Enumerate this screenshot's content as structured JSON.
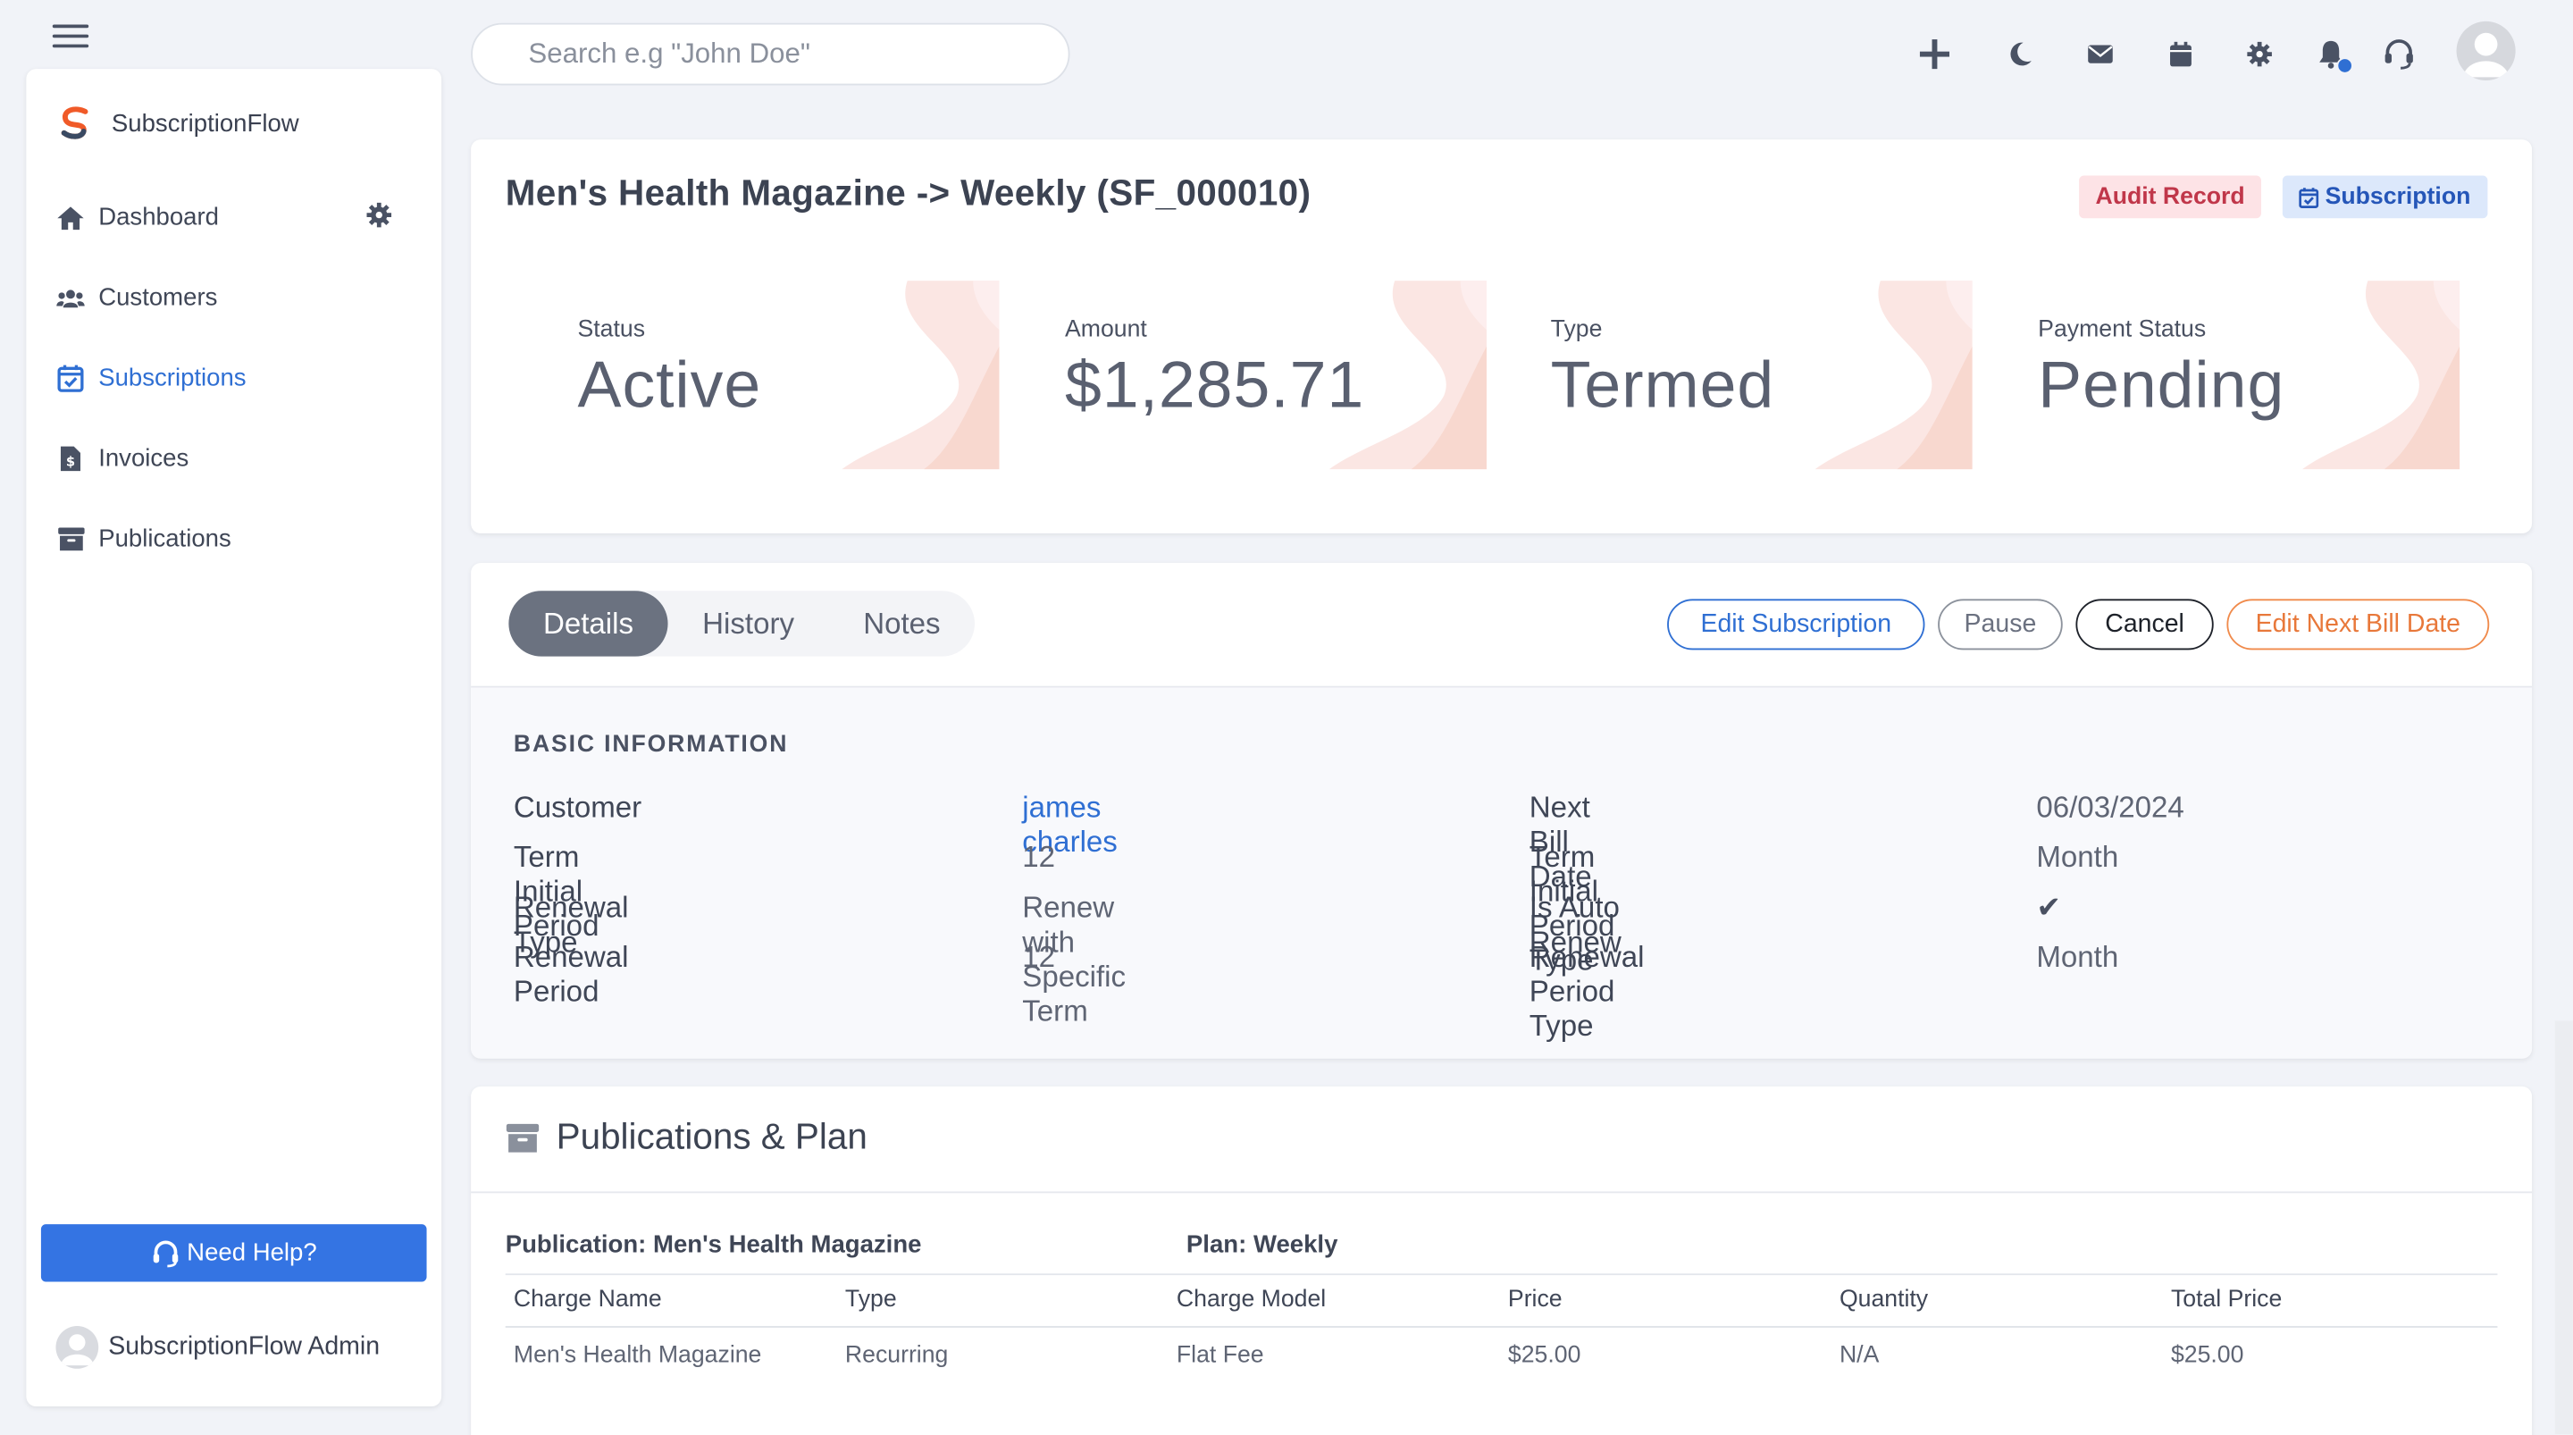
{
  "search": {
    "placeholder": "Search e.g \"John Doe\""
  },
  "sidebar": {
    "brand": "SubscriptionFlow",
    "items": [
      {
        "label": "Dashboard",
        "icon": "home-icon"
      },
      {
        "label": "Customers",
        "icon": "users-icon"
      },
      {
        "label": "Subscriptions",
        "icon": "calendar-check-icon",
        "active": true
      },
      {
        "label": "Invoices",
        "icon": "invoice-icon"
      },
      {
        "label": "Publications",
        "icon": "archive-icon"
      }
    ],
    "help_label": "Need Help?",
    "admin_name": "SubscriptionFlow Admin"
  },
  "topbar": {
    "icons": [
      "plus-icon",
      "moon-icon",
      "mail-icon",
      "calendar-icon",
      "gear-icon",
      "bell-icon",
      "headset-icon",
      "user-avatar"
    ]
  },
  "subscription": {
    "title": "Men's Health Magazine -> Weekly (SF_000010)",
    "badge_audit": "Audit Record",
    "badge_subscription": "Subscription",
    "stats": [
      {
        "label": "Status",
        "value": "Active"
      },
      {
        "label": "Amount",
        "value": "$1,285.71"
      },
      {
        "label": "Type",
        "value": "Termed"
      },
      {
        "label": "Payment Status",
        "value": "Pending"
      }
    ]
  },
  "details": {
    "tabs": [
      "Details",
      "History",
      "Notes"
    ],
    "buttons": {
      "edit": "Edit Subscription",
      "pause": "Pause",
      "cancel": "Cancel",
      "next_bill": "Edit Next Bill Date"
    },
    "section_title": "BASIC INFORMATION",
    "rows": [
      {
        "label": "Customer",
        "value": "james charles",
        "label2": "Next Bill Date",
        "value2": "06/03/2024"
      },
      {
        "label": "Term Initial Period",
        "value": "12",
        "label2": "Term Initial Period Type",
        "value2": "Month"
      },
      {
        "label": "Renewal Type",
        "value": "Renew with Specific Term",
        "label2": "Is Auto Renew",
        "value2": "✔"
      },
      {
        "label": "Renewal Period",
        "value": "12",
        "label2": "Renewal Period Type",
        "value2": "Month"
      }
    ]
  },
  "publications": {
    "title": "Publications & Plan",
    "publication_label": "Publication: Men's Health Magazine",
    "plan_label": "Plan: Weekly",
    "columns": [
      "Charge Name",
      "Type",
      "Charge Model",
      "Price",
      "Quantity",
      "Total Price"
    ],
    "rows": [
      [
        "Men's Health Magazine",
        "Recurring",
        "Flat Fee",
        "$25.00",
        "N/A",
        "$25.00"
      ]
    ]
  },
  "colors": {
    "accent": "#2f6fd3",
    "orange": "#e8783a",
    "audit": "#c0374a",
    "active_tab": "#6b7280"
  }
}
